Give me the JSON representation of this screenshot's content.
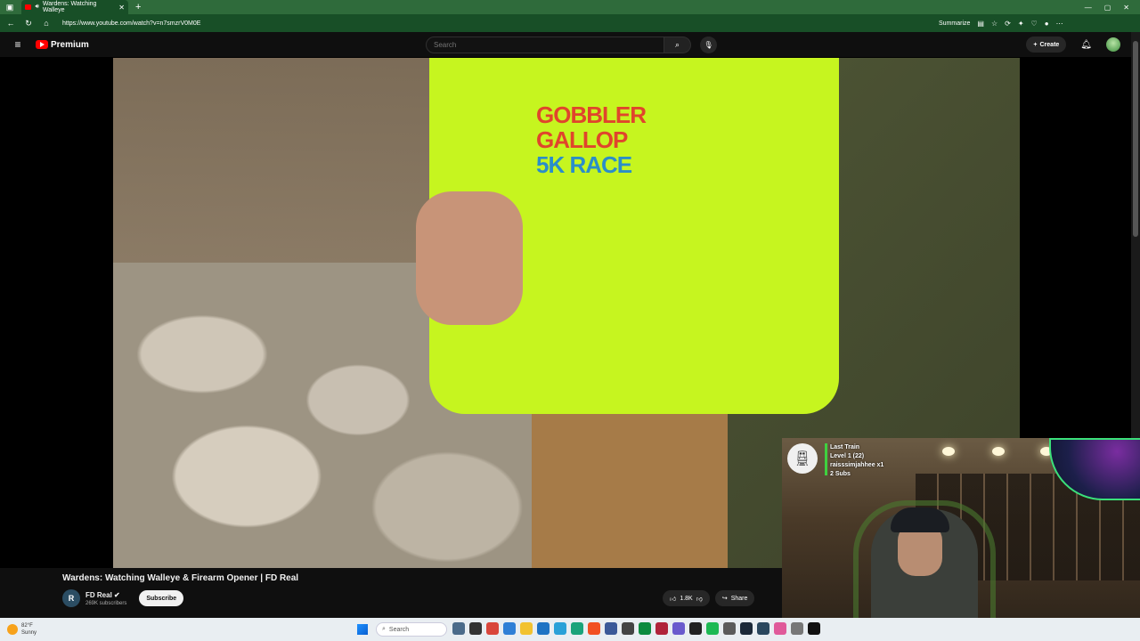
{
  "browser": {
    "tab_title": "Wardens: Watching Walleye",
    "url": "https://www.youtube.com/watch?v=n7smzrV0M0E",
    "summarize_label": "Summarize"
  },
  "masthead": {
    "logo_text": "Premium",
    "search_placeholder": "Search",
    "create_label": "Create"
  },
  "video": {
    "shirt_line1": "GOBBLER",
    "shirt_line2": "GALLOP",
    "shirt_line3": "5K RACE",
    "title": "Wardens: Watching Walleye & Firearm Opener | FD Real"
  },
  "channel": {
    "name": "FD Real",
    "subscribers": "269K subscribers",
    "avatar_letters": "R",
    "subscribe_label": "Subscribe"
  },
  "actions": {
    "likes": "1.8K",
    "share_label": "Share"
  },
  "overlay": {
    "line1": "Last Train",
    "line2": "Level 1  (22)",
    "line3": "raisssimjahhee x1",
    "line4": "2 Subs"
  },
  "taskbar": {
    "temperature": "82°F",
    "condition": "Sunny",
    "search_label": "Search"
  },
  "colors": {
    "browser_green": "#184f27",
    "youtube_red": "#ff0000",
    "background": "#0f0f0f"
  }
}
